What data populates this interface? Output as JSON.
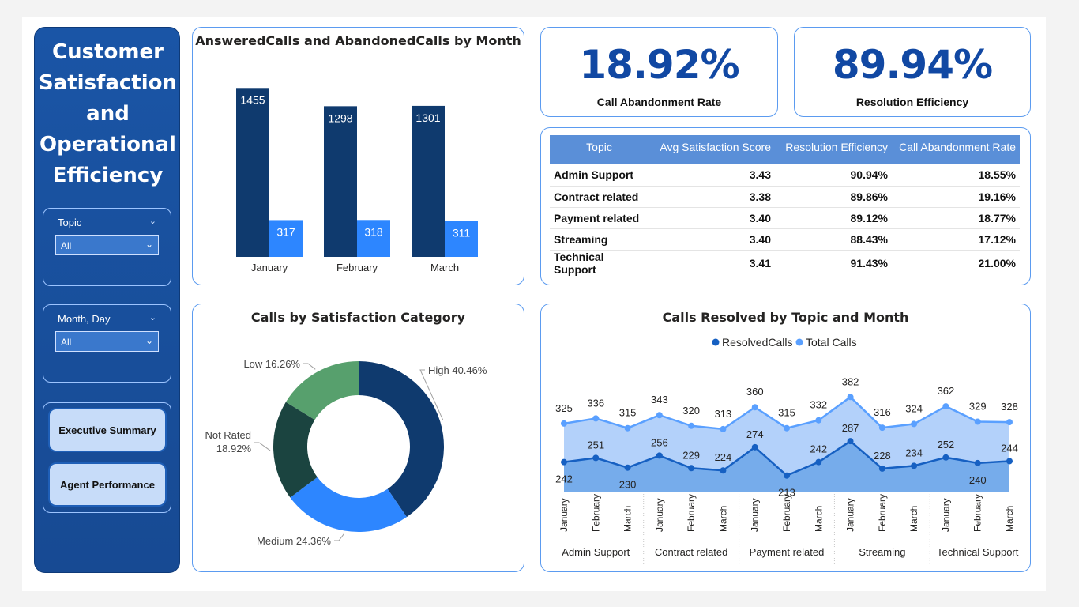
{
  "sidebar": {
    "title_lines": [
      "Customer",
      "Satisfaction",
      "and",
      "Operational",
      "Efficiency"
    ],
    "slicers": [
      {
        "label": "Topic",
        "value": "All"
      },
      {
        "label": "Month, Day",
        "value": "All"
      }
    ],
    "nav_buttons": [
      "Executive Summary",
      "Agent Performance"
    ]
  },
  "kpis": [
    {
      "value": "18.92%",
      "label": "Call Abandonment Rate"
    },
    {
      "value": "89.94%",
      "label": "Resolution Efficiency"
    }
  ],
  "table": {
    "headers": [
      "Topic",
      "Avg Satisfaction Score",
      "Resolution Efficiency",
      "Call Abandonment Rate"
    ],
    "rows": [
      [
        "Admin Support",
        "3.43",
        "90.94%",
        "18.55%"
      ],
      [
        "Contract related",
        "3.38",
        "89.86%",
        "19.16%"
      ],
      [
        "Payment related",
        "3.40",
        "89.12%",
        "18.77%"
      ],
      [
        "Streaming",
        "3.40",
        "88.43%",
        "17.12%"
      ],
      [
        "Technical Support",
        "3.41",
        "91.43%",
        "21.00%"
      ]
    ]
  },
  "colors": {
    "dark_blue": "#0f3a6e",
    "bright_blue": "#2d86ff",
    "kpi_blue": "#1148a3",
    "donut_high": "#0f3a6e",
    "donut_medium": "#2d86ff",
    "donut_not_rated": "#1b4440",
    "donut_low": "#57a06d",
    "line_resolved": "#1660c2",
    "line_total": "#5aa0ff"
  },
  "chart_data": [
    {
      "type": "bar",
      "title": "AnsweredCalls and AbandonedCalls by Month",
      "categories": [
        "January",
        "February",
        "March"
      ],
      "series": [
        {
          "name": "",
          "values": [
            1455,
            1298,
            1301
          ]
        },
        {
          "name": "",
          "values": [
            317,
            318,
            311
          ]
        }
      ]
    },
    {
      "type": "pie",
      "title": "Calls by Satisfaction Category",
      "labels": [
        "High",
        "Medium",
        "Not Rated",
        "Low"
      ],
      "values": [
        40.46,
        24.36,
        18.92,
        16.26
      ],
      "value_labels": [
        "40.46%",
        "24.36%",
        "18.92%",
        "16.26%"
      ]
    },
    {
      "type": "area",
      "title": "Calls Resolved by Topic and Month",
      "groups": [
        "Admin Support",
        "Contract related",
        "Payment related",
        "Streaming",
        "Technical Support"
      ],
      "months": [
        "January",
        "February",
        "March"
      ],
      "series": [
        {
          "name": "ResolvedCalls",
          "values": [
            242,
            251,
            230,
            256,
            229,
            224,
            274,
            213,
            242,
            287,
            228,
            234,
            252,
            240,
            244
          ]
        },
        {
          "name": "Total Calls",
          "values": [
            325,
            336,
            315,
            343,
            320,
            313,
            360,
            315,
            332,
            382,
            316,
            324,
            362,
            329,
            328
          ]
        }
      ]
    }
  ]
}
